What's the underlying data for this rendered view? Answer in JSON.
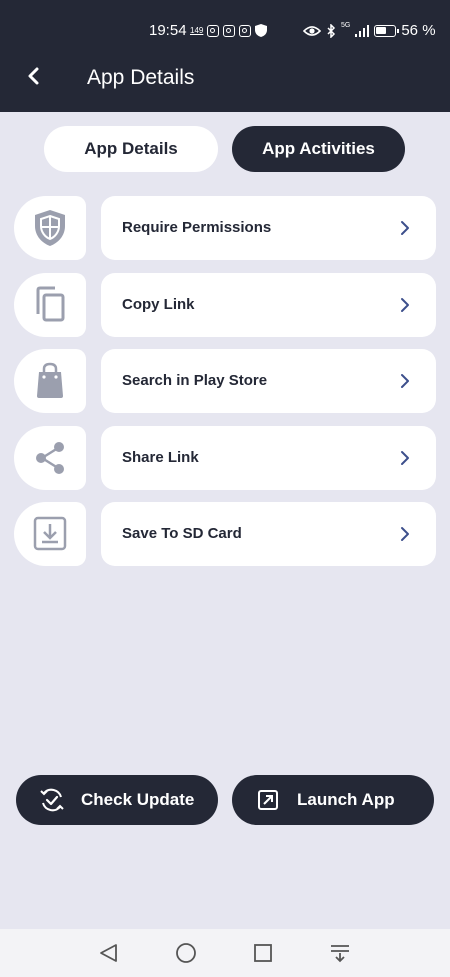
{
  "status_bar": {
    "time": "19:54",
    "notif_count": "149",
    "network": "5G",
    "battery_text": "56 %"
  },
  "header": {
    "title": "App Details"
  },
  "tabs": [
    {
      "label": "App Details",
      "active": true
    },
    {
      "label": "App Activities",
      "active": false
    }
  ],
  "actions": [
    {
      "label": "Require Permissions",
      "icon": "shield-icon"
    },
    {
      "label": "Copy Link",
      "icon": "copy-icon"
    },
    {
      "label": "Search in Play Store",
      "icon": "shopping-bag-icon"
    },
    {
      "label": "Share Link",
      "icon": "share-icon"
    },
    {
      "label": "Save To SD Card",
      "icon": "download-icon"
    }
  ],
  "buttons": {
    "check_update": "Check Update",
    "launch_app": "Launch App"
  },
  "colors": {
    "primary_dark": "#242836",
    "background": "#e6e6f0",
    "card": "#ffffff",
    "icon_gray": "#9b9fae",
    "chevron": "#3d4f8c"
  }
}
